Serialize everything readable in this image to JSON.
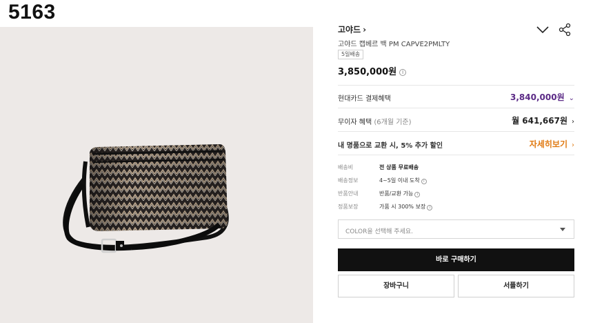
{
  "watermark": "5163",
  "brand": {
    "name": "고야드",
    "chevron": "›"
  },
  "icons": {
    "down": "chevron-down-icon",
    "share": "share-icon"
  },
  "product": {
    "name": "고야드 캡베르 백 PM CAPVE2PMLTY",
    "badge": "5일배송",
    "price": "3,850,000원",
    "price_info": "i"
  },
  "benefits": {
    "card_label": "현대카드 결제혜택",
    "card_price": "3,840,000원",
    "installment_label": "무이자 혜택",
    "installment_note": "(6개월 기준)",
    "installment_value": "월 641,667원",
    "promo_label": "내 명품으로 교환 시, 5% 추가 할인",
    "promo_link": "자세히보기"
  },
  "details": [
    {
      "key": "배송비",
      "value": "전 상품 무료배송",
      "bold": true,
      "info": false
    },
    {
      "key": "배송정보",
      "value": "4~5일 이내 도착",
      "bold": false,
      "info": true
    },
    {
      "key": "반품안내",
      "value": "반품/교환 가능",
      "bold": false,
      "info": true
    },
    {
      "key": "정품보장",
      "value": "가품 시 300% 보장",
      "bold": false,
      "info": true
    }
  ],
  "select": {
    "placeholder": "COLOR을 선택해 주세요."
  },
  "buttons": {
    "buy": "바로 구매하기",
    "cart": "장바구니",
    "shopping": "서플하기"
  },
  "colors": {
    "accent_purple": "#5b2a86",
    "accent_orange": "#e07a12",
    "buy_bg": "#111111",
    "image_bg": "#ede9e7"
  }
}
